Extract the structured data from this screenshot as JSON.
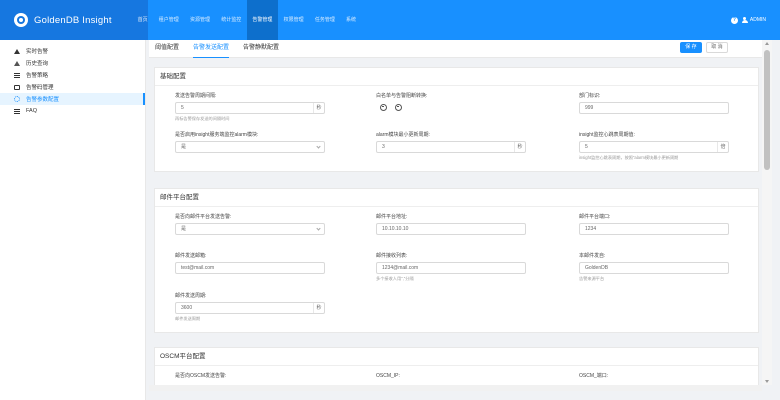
{
  "app": {
    "title": "GoldenDB Insight"
  },
  "nav": {
    "items": [
      {
        "label": "首页"
      },
      {
        "label": "租户管理"
      },
      {
        "label": "资源管理"
      },
      {
        "label": "统计监控"
      },
      {
        "label": "告警管理",
        "active": true
      },
      {
        "label": "权限管理"
      },
      {
        "label": "任务管理"
      },
      {
        "label": "系统"
      }
    ]
  },
  "header_right": {
    "help": "?",
    "user": "ADMIN"
  },
  "sidebar": {
    "items": [
      {
        "label": "实时告警",
        "icon": "warning-icon"
      },
      {
        "label": "历史查询",
        "icon": "history-icon"
      },
      {
        "label": "告警策略",
        "icon": "policy-icon"
      },
      {
        "label": "告警码管理",
        "icon": "code-icon"
      },
      {
        "label": "告警参数配置",
        "icon": "gear-icon",
        "active": true
      },
      {
        "label": "FAQ",
        "icon": "faq-icon"
      }
    ]
  },
  "tabs": [
    {
      "label": "阈值配置"
    },
    {
      "label": "告警发送配置",
      "active": true
    },
    {
      "label": "告警静默配置"
    }
  ],
  "toolbar": {
    "save_label": "保 存",
    "cancel_label": "取 消"
  },
  "basic": {
    "title": "基础配置",
    "send_period": {
      "label": "发送告警周期间隔:",
      "value": "5",
      "unit": "秒",
      "hint": "再标告警保存发送的间隔时间"
    },
    "whitelist": {
      "label": "白名单与告警阻断转换:"
    },
    "dept": {
      "label": "部门标识:",
      "value": "999"
    },
    "use_insight": {
      "label": "是否启用insight服务端监控alarm模块:",
      "value": "是"
    },
    "alarm_min_period": {
      "label": "alarm模块最小更新周期:",
      "value": "3",
      "unit": "秒"
    },
    "heartbeat": {
      "label": "insight监控心跳表周期值:",
      "value": "5",
      "unit": "倍",
      "hint": "insight监控心跳表周期，按照“alarm模块最小更新周期"
    }
  },
  "mail": {
    "title": "邮件平台配置",
    "enable": {
      "label": "是否向邮件平台发送告警:",
      "value": "是"
    },
    "address": {
      "label": "邮件平台地址:",
      "value": "10.10.10.10"
    },
    "port": {
      "label": "邮件平台端口:",
      "value": "1234"
    },
    "sender": {
      "label": "邮件发送邮箱:",
      "value": "test@mail.com"
    },
    "receivers": {
      "label": "邮件接收列表:",
      "value": "1234@mail.com",
      "hint": "多个接收人用\",\"分隔"
    },
    "subject": {
      "label": "本邮件发自:",
      "value": "GoldenDB",
      "hint": "告警来源平台"
    },
    "period": {
      "label": "邮件发送周期:",
      "value": "3600",
      "unit": "秒",
      "hint": "邮件发送周期"
    }
  },
  "oscm": {
    "title": "OSCM平台配置",
    "enable": {
      "label": "是否向OSCM发送告警:"
    },
    "ip": {
      "label": "OSCM_IP:"
    },
    "port": {
      "label": "OSCM_端口:"
    }
  }
}
